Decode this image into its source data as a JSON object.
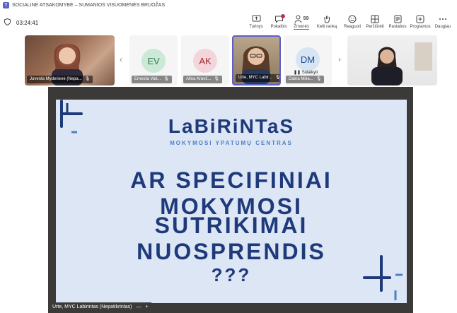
{
  "window": {
    "title": "SOCIALINĖ ATSAKOMYBĖ – SUMANIOS VISUOMENĖS BRUOŽAS"
  },
  "meeting": {
    "elapsed": "03:24:41"
  },
  "toolbar": {
    "turinys": "Turinys",
    "pokalbis": "Pokalbis",
    "zmones": "Žmonės",
    "zmones_count": "59",
    "kelti_ranka": "Kelti ranką",
    "reaguoti": "Reaguoti",
    "perziureti": "Peržiūrėti",
    "pastabos": "Pastabos",
    "programos": "Programos",
    "daugiau": "Daugiau"
  },
  "participants": [
    {
      "name": "Juventa Myderienė (Nepa...",
      "initials": ""
    },
    {
      "name": "Ernesta Vait...",
      "initials": "EV",
      "color": "#cce8d6",
      "text_color": "#2e7d4f"
    },
    {
      "name": "Alina Kravč...",
      "initials": "AK",
      "color": "#f3d6dc",
      "text_color": "#a4262c"
    },
    {
      "name": "Urte, MYC Labir...",
      "initials": ""
    },
    {
      "name": "Daina Milia...",
      "initials": "DM",
      "color": "#d6e4f3",
      "text_color": "#1f4e8c",
      "status": "Sulaikyti"
    },
    {
      "name": "",
      "initials": ""
    }
  ],
  "slide": {
    "brand": "LaBiRiNTaS",
    "subtitle": "MOKYMOSI YPATUMŲ CENTRAS",
    "line1": "AR SPECIFINIAI MOKYMOSI",
    "line2": "SUTRIKIMAI NUOSPRENDIS",
    "line3": "???"
  },
  "presenter": {
    "name": "Urte, MYC Labirintas (Nepatikrintas)"
  },
  "colors": {
    "accent": "#5b5fc7",
    "slide_text": "#1f3a7a",
    "slide_bg": "#dde6f5"
  }
}
